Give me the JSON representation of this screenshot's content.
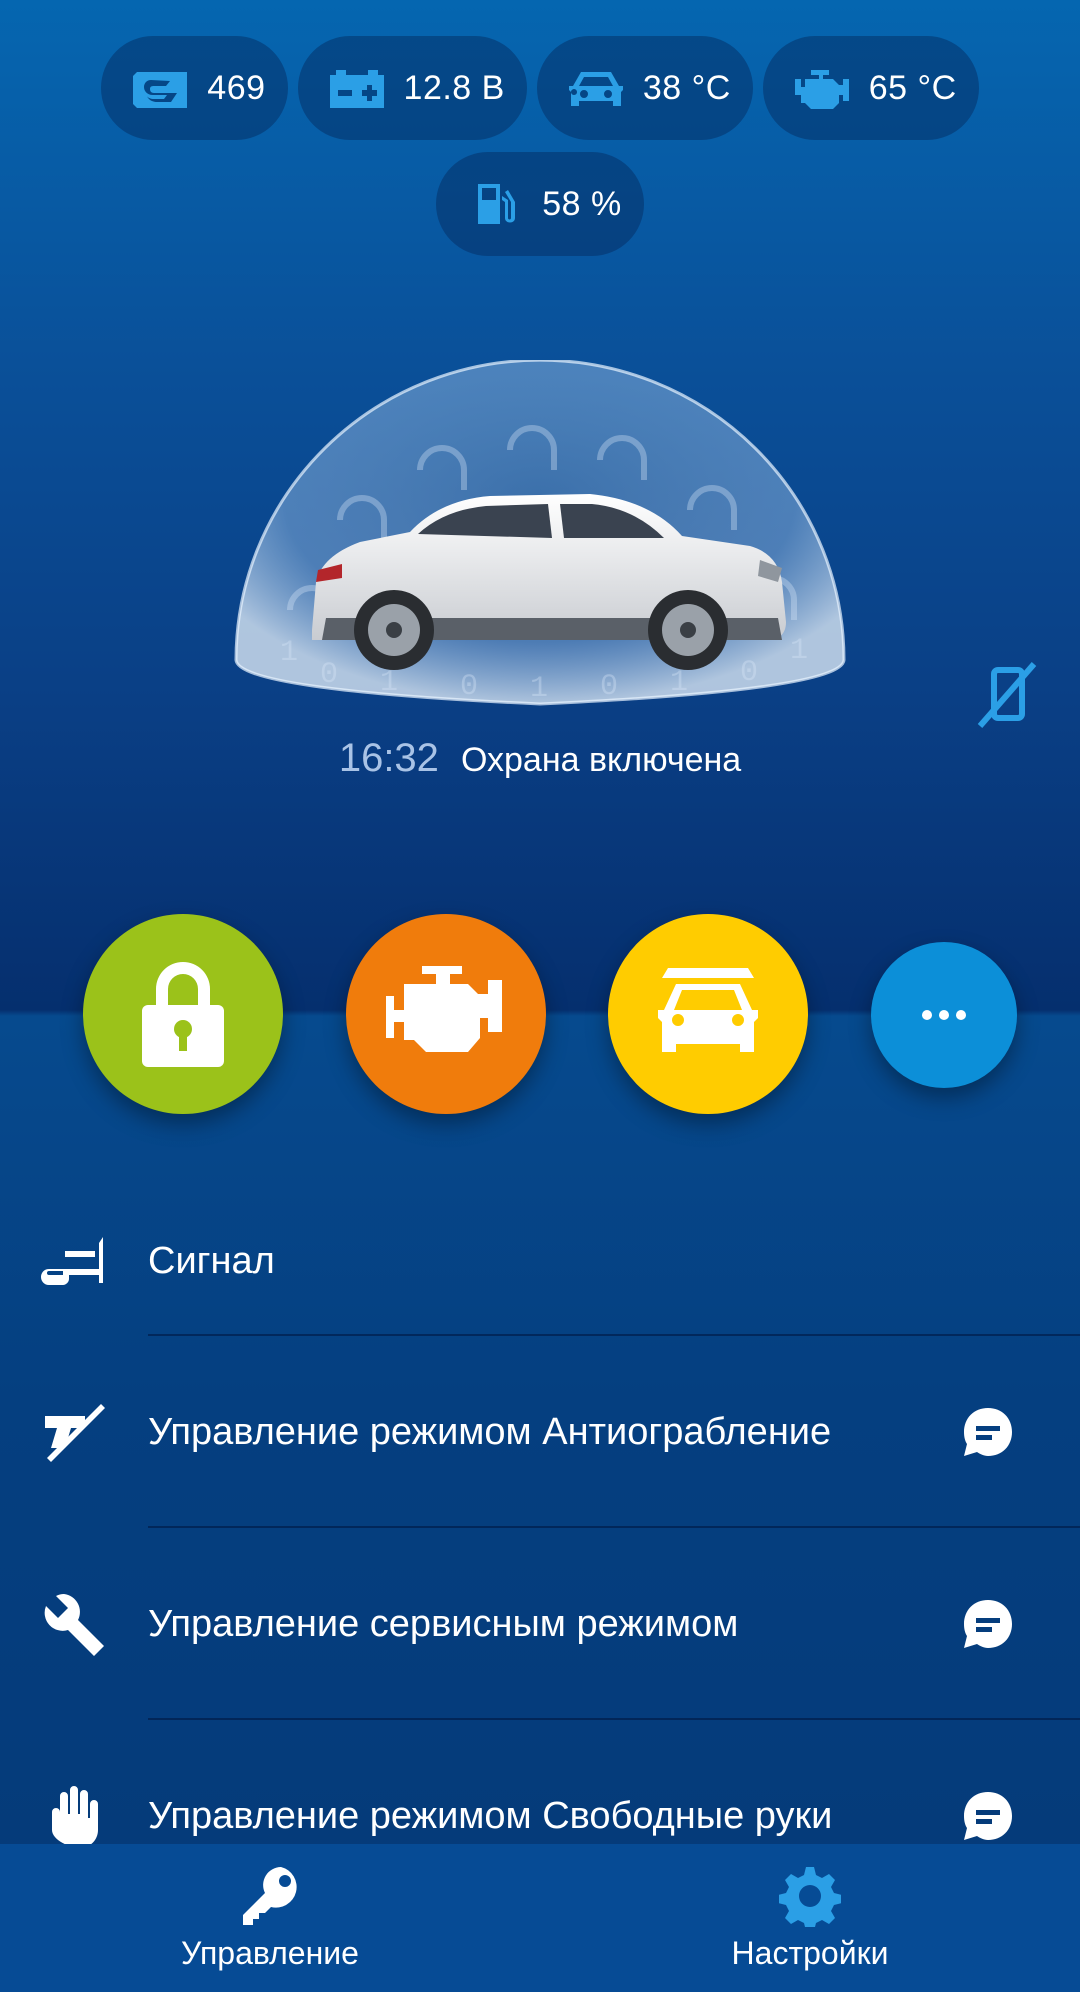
{
  "status": {
    "pills": [
      {
        "icon": "balance-icon",
        "value": "469"
      },
      {
        "icon": "battery-icon",
        "value": "12.8 В"
      },
      {
        "icon": "car-temp-icon",
        "value": "38 °C"
      },
      {
        "icon": "engine-temp-icon",
        "value": "65 °C"
      },
      {
        "icon": "fuel-icon",
        "value": "58 %"
      }
    ]
  },
  "car": {
    "time": "16:32",
    "state": "Охрана включена"
  },
  "actions": [
    {
      "name": "lock",
      "color": "#9bc21a"
    },
    {
      "name": "engine-start",
      "color": "#f07c0c"
    },
    {
      "name": "car-trunk",
      "color": "#ffcc00"
    },
    {
      "name": "more",
      "color": "#0c8fd8"
    }
  ],
  "list": {
    "items": [
      {
        "icon": "horn-icon",
        "label": "Сигнал",
        "sms": false
      },
      {
        "icon": "no-gun-icon",
        "label": "Управление режимом Антиограбление",
        "sms": true
      },
      {
        "icon": "wrench-icon",
        "label": "Управление сервисным режимом",
        "sms": true
      },
      {
        "icon": "hand-icon",
        "label": "Управление режимом Свободные руки",
        "sms": true
      }
    ]
  },
  "nav": {
    "tabs": [
      {
        "label": "Управление",
        "icon": "key-icon",
        "active": true
      },
      {
        "label": "Настройки",
        "icon": "gear-icon",
        "active": false
      }
    ]
  },
  "colors": {
    "accent": "#2b9fe6",
    "background": "#0a4f98"
  }
}
